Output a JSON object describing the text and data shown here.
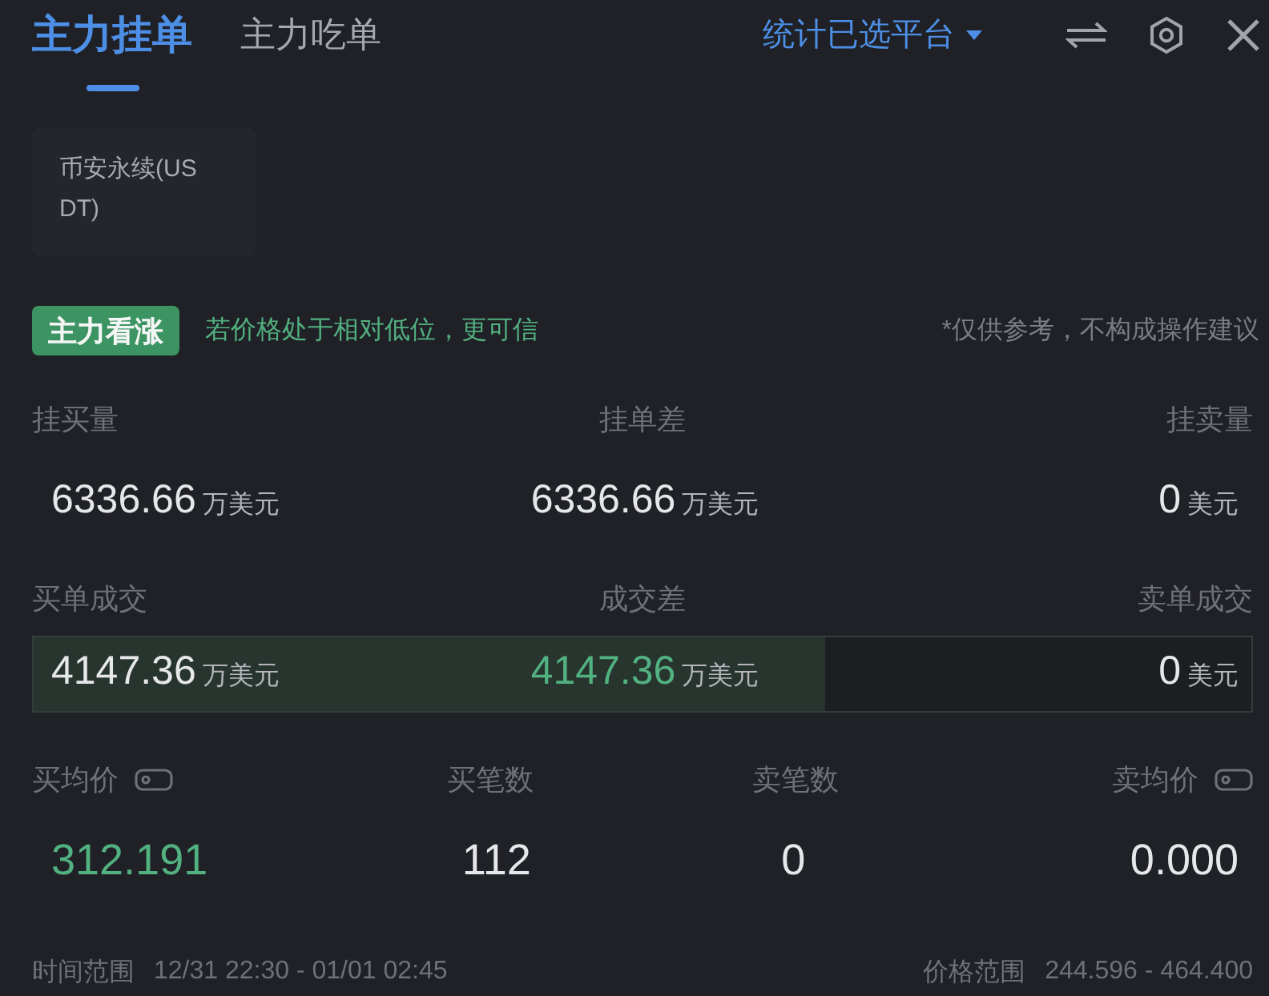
{
  "header": {
    "tabs": [
      {
        "label": "主力挂单",
        "selected": true
      },
      {
        "label": "主力吃单",
        "selected": false
      }
    ],
    "platform_filter": "统计已选平台"
  },
  "platform_chip": {
    "label": "币安永续(USDT)"
  },
  "signal": {
    "badge": "主力看涨",
    "hint": "若价格处于相对低位，更可信",
    "disclaimer": "*仅供参考，不构成操作建议"
  },
  "order_book": {
    "columns": [
      {
        "label": "挂买量",
        "value": "6336.66",
        "unit": "万美元",
        "highlighted": false
      },
      {
        "label": "挂单差",
        "value": "6336.66",
        "unit": "万美元",
        "highlighted": false
      },
      {
        "label": "挂卖量",
        "value": "0",
        "unit": "美元",
        "highlighted": false
      }
    ]
  },
  "trades": {
    "level": 0.65,
    "columns": [
      {
        "label": "买单成交",
        "value": "4147.36",
        "unit": "万美元",
        "highlighted": false
      },
      {
        "label": "成交差",
        "value": "4147.36",
        "unit": "万美元",
        "highlighted": true
      },
      {
        "label": "卖单成交",
        "value": "0",
        "unit": "美元",
        "highlighted": false
      }
    ]
  },
  "averages": {
    "columns": [
      {
        "label": "买均价",
        "value": "312.191",
        "highlighted": true,
        "price_tag": true
      },
      {
        "label": "买笔数",
        "value": "112",
        "highlighted": false,
        "price_tag": false
      },
      {
        "label": "卖笔数",
        "value": "0",
        "highlighted": false,
        "price_tag": false
      },
      {
        "label": "卖均价",
        "value": "0.000",
        "highlighted": false,
        "price_tag": true
      }
    ]
  },
  "footer": {
    "time_label": "时间范围",
    "time_range": "12/31 22:30 - 01/01 02:45",
    "price_label": "价格范围",
    "price_range": "244.596 - 464.400"
  }
}
